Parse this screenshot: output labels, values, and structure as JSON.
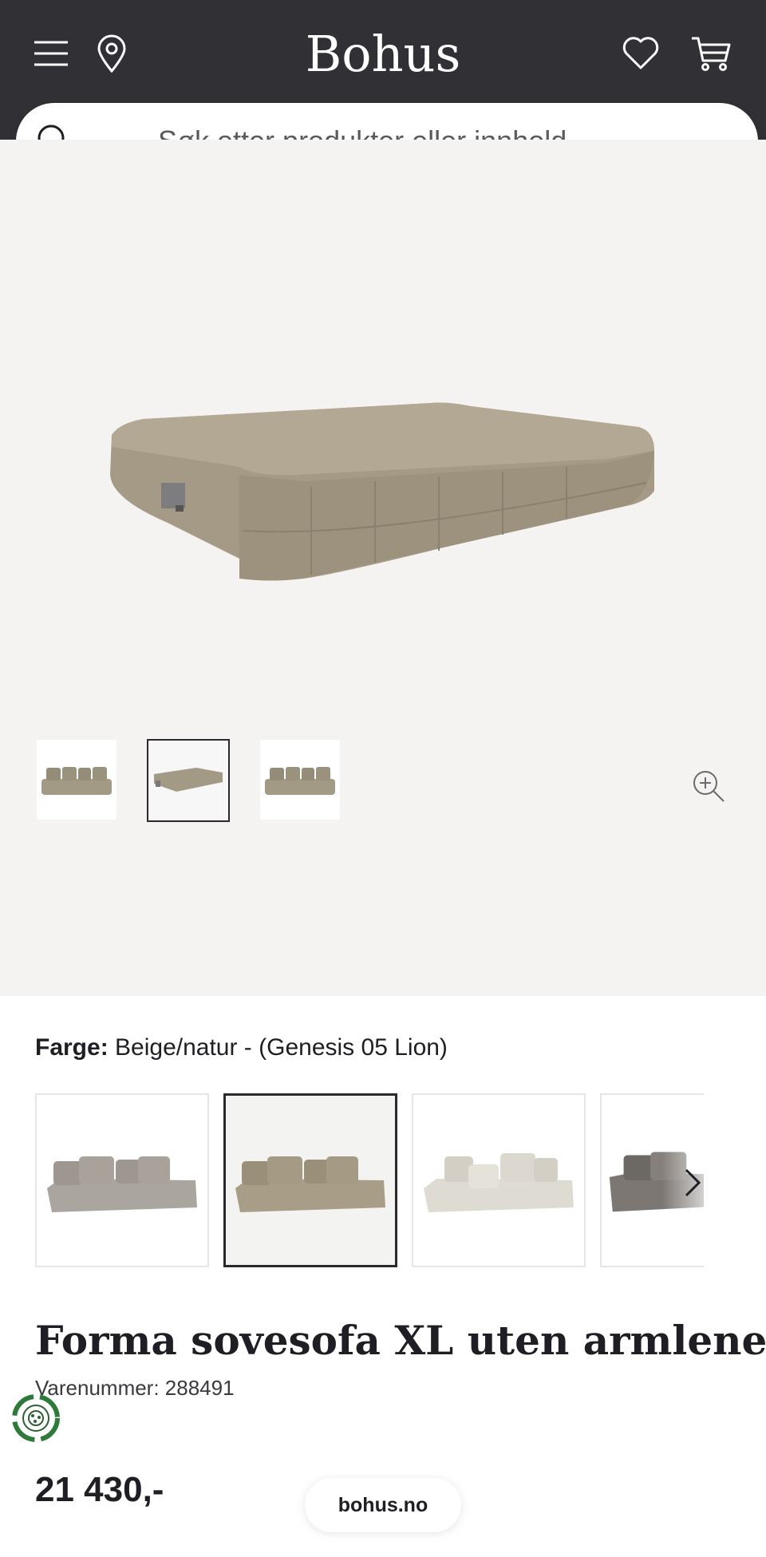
{
  "header": {
    "logo": "Bohus",
    "icons": [
      "menu-icon",
      "location-pin-icon",
      "heart-icon",
      "cart-icon"
    ]
  },
  "search": {
    "placeholder": "Søk etter produkter eller innhold ..."
  },
  "gallery": {
    "thumbnails_count": 3,
    "selected_thumbnail": 2
  },
  "color": {
    "label": "Farge:",
    "value": "Beige/natur - (Genesis 05 Lion)",
    "swatches_visible": 4,
    "selected_swatch": 2
  },
  "product": {
    "title": "Forma sovesofa XL uten armlene",
    "sku": "Varenummer: 288491",
    "price": "21 430,-"
  },
  "footer": {
    "domain_pill": "bohus.no"
  },
  "colors": {
    "header_bg": "#313035",
    "gallery_bg": "#f5f3f1",
    "text": "#1e1e24"
  }
}
